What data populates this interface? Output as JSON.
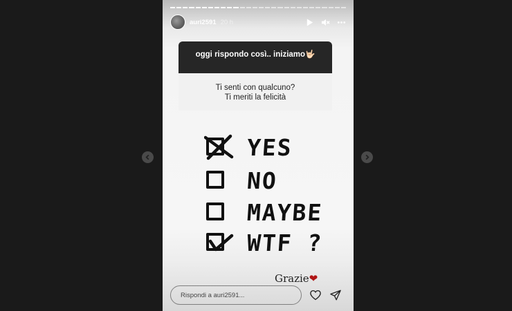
{
  "story": {
    "username": "auri2591",
    "time": "20 h",
    "progress_segments": 28,
    "progress_completed": 11
  },
  "question": {
    "header": "oggi rispondo così.. iniziamo🤟🏻",
    "body_line1": "Ti senti con qualcuno?",
    "body_line2": "Ti meriti la felicità"
  },
  "checklist": [
    {
      "label": "YES",
      "mark": "x"
    },
    {
      "label": "NO",
      "mark": "empty"
    },
    {
      "label": "MAYBE",
      "mark": "empty"
    },
    {
      "label": "WTF ?",
      "mark": "check"
    }
  ],
  "signature": {
    "text": "Grazie",
    "heart": "❤"
  },
  "reply": {
    "placeholder": "Rispondi a auri2591..."
  },
  "icons": {
    "play": "play-icon",
    "mute": "speaker-muted-icon",
    "more": "more-horizontal-icon",
    "like": "heart-outline-icon",
    "send": "paper-plane-icon",
    "prev": "chevron-left-icon",
    "next": "chevron-right-icon"
  },
  "colors": {
    "page_bg": "#1a1a1a",
    "question_header_bg": "#262626",
    "heart": "#b01515"
  }
}
